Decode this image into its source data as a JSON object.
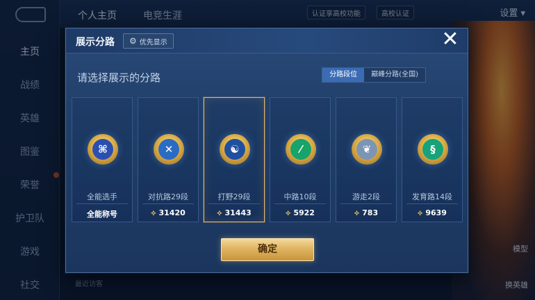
{
  "background": {
    "nav_items": [
      "主页",
      "战绩",
      "英雄",
      "图鉴",
      "荣誉",
      "护卫队",
      "游戏",
      "社交"
    ],
    "top_tabs": [
      "个人主页",
      "电竞生涯"
    ],
    "chip_campus": "认证享高校功能",
    "chip_verify": "高校认证",
    "settings_label": "设置",
    "recent_visitors": "最近访客",
    "side_buttons": [
      "模型",
      "换英雄"
    ]
  },
  "modal": {
    "title": "展示分路",
    "priority_label": "优先显示",
    "prompt": "请选择展示的分路",
    "toggle_options": [
      "分路段位",
      "巅峰分路(全国)"
    ],
    "toggle_selected": 0,
    "confirm_label": "确定",
    "cards": [
      {
        "label": "全能选手",
        "value": "全能称号",
        "emblem_color": "#2b4fb0",
        "icon": "all-round-icon",
        "glyph": "⌘",
        "has_coin": false
      },
      {
        "label": "对抗路29段",
        "value": "31420",
        "emblem_color": "#2a6bc4",
        "icon": "clash-lane-icon",
        "glyph": "✕",
        "has_coin": true
      },
      {
        "label": "打野29段",
        "value": "31443",
        "emblem_color": "#1f4fa0",
        "icon": "jungle-icon",
        "glyph": "☯",
        "has_coin": true,
        "selected": true
      },
      {
        "label": "中路10段",
        "value": "5922",
        "emblem_color": "#17a36a",
        "icon": "mid-lane-icon",
        "glyph": "⁄",
        "has_coin": true
      },
      {
        "label": "游走2段",
        "value": "783",
        "emblem_color": "#7d95b5",
        "icon": "roam-icon",
        "glyph": "❦",
        "has_coin": true
      },
      {
        "label": "发育路14段",
        "value": "9639",
        "emblem_color": "#15a37a",
        "icon": "farm-lane-icon",
        "glyph": "§",
        "has_coin": true
      }
    ]
  },
  "colors": {
    "accent_gold": "#e4b46a",
    "selected_toggle": "#3a6cb5"
  }
}
